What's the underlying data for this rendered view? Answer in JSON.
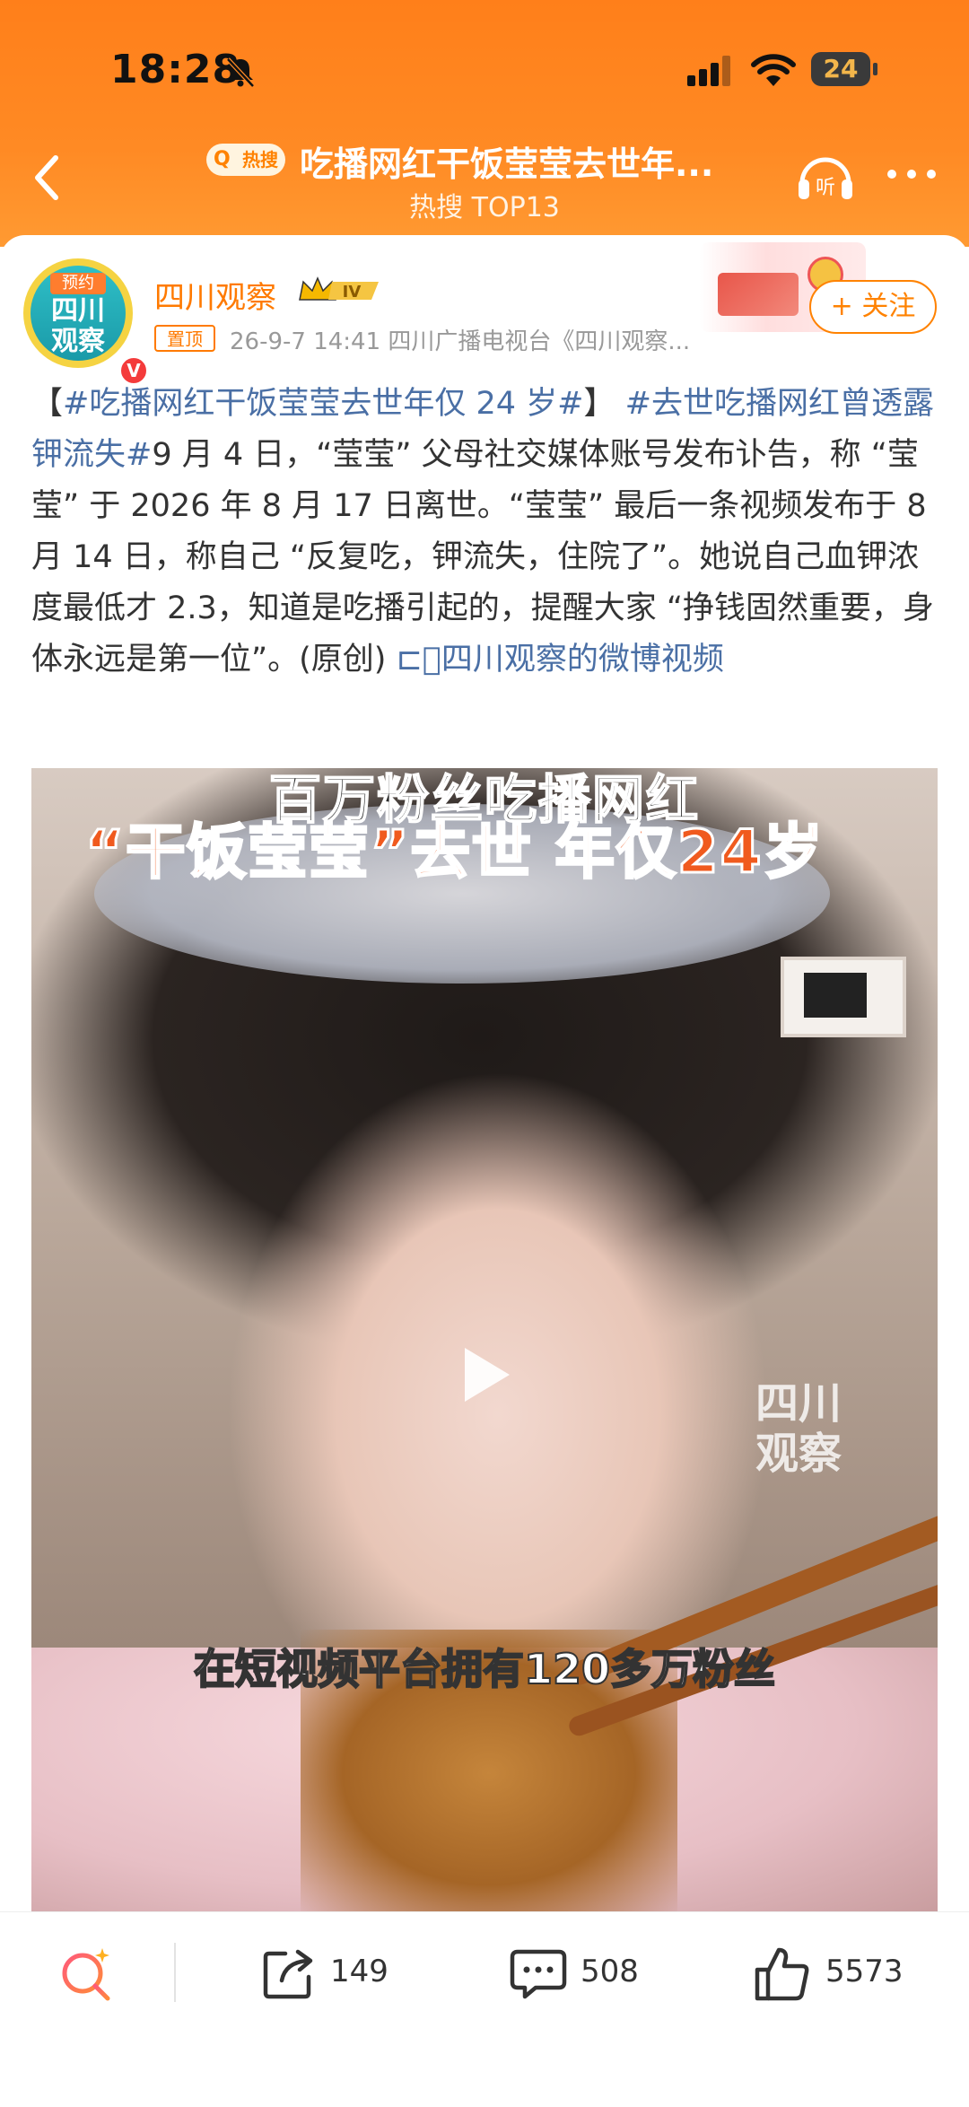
{
  "status_bar": {
    "time": "18:28",
    "battery": "24"
  },
  "nav": {
    "hot_tag": "热搜",
    "title": "吃播网红干饭莹莹去世年...",
    "subtitle": "热搜 TOP13"
  },
  "author": {
    "avatar_tag": "预约",
    "avatar_text": "四川\n观察",
    "name": "四川观察",
    "level": "IV",
    "pin_label": "置顶",
    "meta": "26-9-7 14:41  四川广播电视台《四川观察...",
    "follow_label": "+ 关注"
  },
  "post": {
    "bracket_open": "【",
    "tag1": "#吃播网红干饭莹莹去世年仅 24 岁#",
    "bracket_close": "】",
    "tag2": "#去世吃播网红曾透露钾流失#",
    "body": "9 月 4 日，“莹莹” 父母社交媒体账号发布讣告，称 “莹莹” 于 2026 年 8 月 17 日离世。“莹莹” 最后一条视频发布于 8 月 14 日，称自己 “反复吃，钾流失，住院了”。她说自己血钾浓度最低才 2.3，知道是吃播引起的，提醒大家 “挣钱固然重要，身体永远是第一位”。(原创) ",
    "video_link": "四川观察的微博视频"
  },
  "video": {
    "title_line1": "百万粉丝吃播网红",
    "title_line2": "“干饭莹莹”去世 年仅24岁",
    "watermark": "四川\n观察",
    "subtitle": "在短视频平台拥有120多万粉丝"
  },
  "actions": {
    "repost_count": "149",
    "comment_count": "508",
    "like_count": "5573"
  },
  "colors": {
    "accent": "#ff8200",
    "link": "#4a6fa5",
    "header": "#ff7f1a"
  }
}
